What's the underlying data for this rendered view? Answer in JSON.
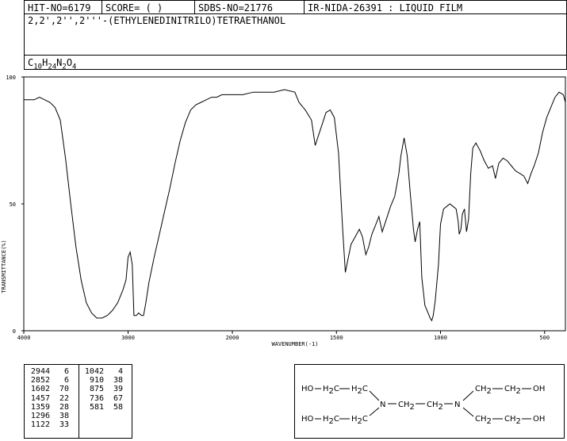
{
  "header": {
    "hit_no": "HIT-NO=6179",
    "score": "SCORE=  (   )",
    "sdbs_no": "SDBS-NO=21776",
    "ir_info": "IR-NIDA-26391 : LIQUID FILM"
  },
  "compound_name": "2,2',2'',2'''-(ETHYLENEDINITRILO)TETRAETHANOL",
  "formula": {
    "c": "C",
    "c_n": "10",
    "h": "H",
    "h_n": "24",
    "n": "N",
    "n_n": "2",
    "o": "O",
    "o_n": "4"
  },
  "peaks": [
    {
      "wavenumber": "2944",
      "transmittance": "6"
    },
    {
      "wavenumber": "2852",
      "transmittance": "6"
    },
    {
      "wavenumber": "1602",
      "transmittance": "70"
    },
    {
      "wavenumber": "1457",
      "transmittance": "22"
    },
    {
      "wavenumber": "1359",
      "transmittance": "28"
    },
    {
      "wavenumber": "1296",
      "transmittance": "38"
    },
    {
      "wavenumber": "1122",
      "transmittance": "33"
    },
    {
      "wavenumber": "1042",
      "transmittance": "4"
    },
    {
      "wavenumber": "910",
      "transmittance": "38"
    },
    {
      "wavenumber": "875",
      "transmittance": "39"
    },
    {
      "wavenumber": "736",
      "transmittance": "67"
    },
    {
      "wavenumber": "581",
      "transmittance": "58"
    }
  ],
  "structure": {
    "ho": "HO",
    "oh": "OH",
    "ch2_h": "H",
    "ch2_c": "C",
    "ch2_2": "2",
    "ch_c": "CH",
    "n": "N"
  },
  "chart_data": {
    "type": "line",
    "xlabel": "WAVENUMBER(-1)",
    "ylabel": "TRANSMITTANCE(%)",
    "xlim": [
      4000,
      400
    ],
    "ylim": [
      0,
      100
    ],
    "x_ticks": [
      "4000",
      "3000",
      "2000",
      "1500",
      "1000",
      "500"
    ],
    "y_ticks": [
      "0",
      "50",
      "100"
    ],
    "series": [
      {
        "x": [
          4000,
          3950,
          3900,
          3850,
          3800,
          3750,
          3700,
          3650,
          3600,
          3550,
          3500,
          3450,
          3400,
          3350,
          3300,
          3250,
          3200,
          3150,
          3100,
          3050,
          3020,
          3000,
          2980,
          2960,
          2944,
          2920,
          2900,
          2870,
          2852,
          2830,
          2800,
          2750,
          2700,
          2650,
          2600,
          2550,
          2500,
          2450,
          2400,
          2350,
          2300,
          2250,
          2200,
          2150,
          2100,
          2050,
          2000,
          1950,
          1900,
          1850,
          1800,
          1750,
          1700,
          1680,
          1650,
          1620,
          1602,
          1590,
          1570,
          1550,
          1530,
          1510,
          1490,
          1470,
          1457,
          1445,
          1430,
          1410,
          1390,
          1375,
          1359,
          1345,
          1330,
          1310,
          1296,
          1280,
          1260,
          1240,
          1220,
          1200,
          1190,
          1175,
          1160,
          1145,
          1130,
          1122,
          1110,
          1100,
          1090,
          1075,
          1060,
          1050,
          1042,
          1035,
          1025,
          1010,
          1000,
          985,
          970,
          955,
          940,
          925,
          915,
          910,
          902,
          895,
          885,
          875,
          865,
          855,
          845,
          830,
          810,
          790,
          770,
          750,
          736,
          720,
          700,
          680,
          660,
          640,
          620,
          600,
          581,
          565,
          550,
          530,
          510,
          490,
          470,
          450,
          430,
          410,
          400
        ],
        "y": [
          91,
          91,
          91,
          92,
          91,
          90,
          88,
          83,
          68,
          50,
          33,
          20,
          11,
          7,
          5,
          5,
          6,
          8,
          11,
          16,
          20,
          29,
          31,
          26,
          6,
          6,
          7,
          6,
          6,
          11,
          19,
          29,
          38,
          47,
          56,
          66,
          75,
          82,
          87,
          89,
          90,
          91,
          92,
          92,
          93,
          93,
          93,
          93,
          94,
          94,
          94,
          95,
          94,
          90,
          87,
          83,
          73,
          76,
          81,
          86,
          87,
          84,
          70,
          40,
          23,
          28,
          34,
          37,
          40,
          37,
          30,
          33,
          38,
          42,
          45,
          39,
          44,
          49,
          53,
          62,
          69,
          76,
          69,
          54,
          40,
          35,
          40,
          43,
          21,
          10,
          7,
          5,
          4,
          6,
          12,
          26,
          42,
          48,
          49,
          50,
          49,
          48,
          43,
          38,
          40,
          46,
          48,
          39,
          44,
          62,
          72,
          74,
          71,
          67,
          64,
          65,
          60,
          66,
          68,
          67,
          65,
          63,
          62,
          61,
          58,
          62,
          65,
          70,
          78,
          84,
          88,
          92,
          94,
          93,
          90
        ]
      }
    ]
  }
}
